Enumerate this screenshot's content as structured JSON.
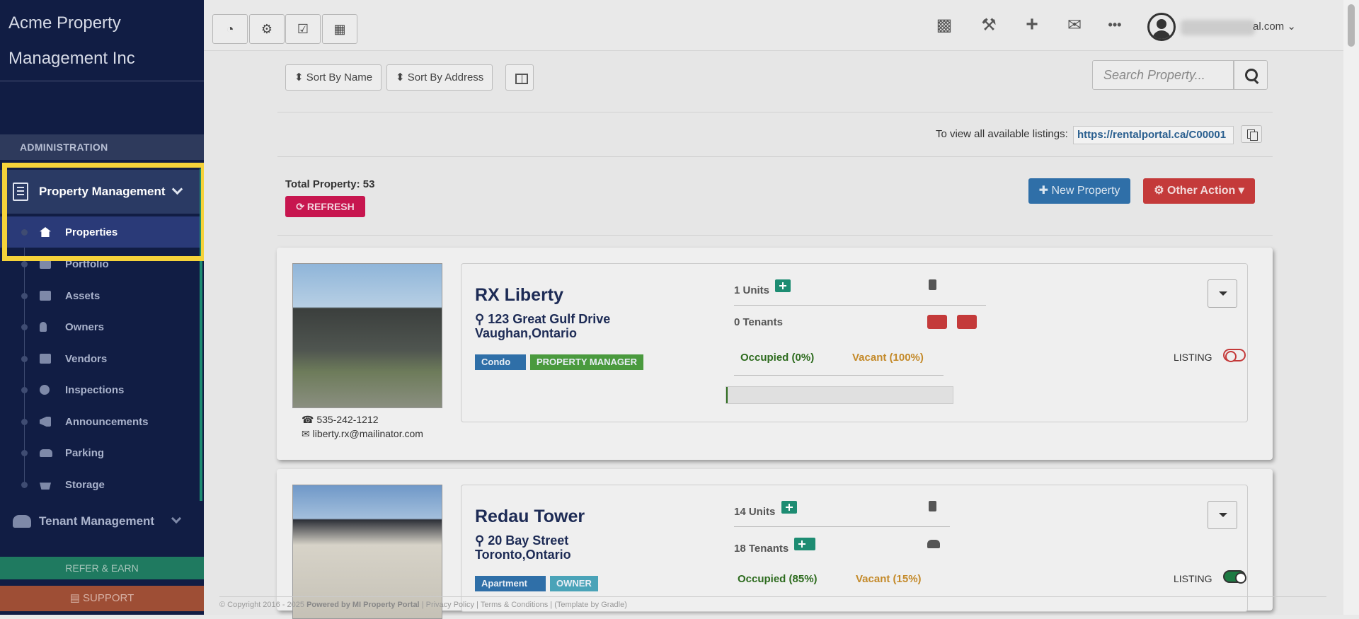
{
  "sidebar": {
    "brand": "Acme Property Management Inc",
    "section": "ADMINISTRATION",
    "group": {
      "label": "Property Management",
      "icon": "building-icon"
    },
    "items": [
      {
        "label": "Properties",
        "icon": "home-icon",
        "active": true
      },
      {
        "label": "Portfolio",
        "icon": "portfolio-icon"
      },
      {
        "label": "Assets",
        "icon": "archive-icon"
      },
      {
        "label": "Owners",
        "icon": "user-icon"
      },
      {
        "label": "Vendors",
        "icon": "briefcase-icon"
      },
      {
        "label": "Inspections",
        "icon": "search-plus-icon"
      },
      {
        "label": "Announcements",
        "icon": "bullhorn-icon"
      },
      {
        "label": "Parking",
        "icon": "car-icon"
      },
      {
        "label": "Storage",
        "icon": "basket-icon"
      }
    ],
    "tenant_group": "Tenant Management",
    "refer": "REFER & EARN",
    "support": "SUPPORT"
  },
  "topbar": {
    "left_icons": [
      "dashboard-icon",
      "gear-icon",
      "calendar-check-icon",
      "calculator-icon"
    ],
    "right_icons": [
      "bar-chart-icon",
      "wrench-icon",
      "plus-icon",
      "envelope-icon",
      "more-icon"
    ],
    "email_visible": "al.com"
  },
  "toolbar": {
    "sort_name": "⬍ Sort By Name",
    "sort_address": "⬍ Sort By Address",
    "search_placeholder": "Search Property..."
  },
  "listings": {
    "label": "To view all available listings:",
    "url": "https://rentalportal.ca/C00001"
  },
  "summary": {
    "total": "Total Property: 53",
    "refresh": "⟳ REFRESH",
    "new_property": "✚ New Property",
    "other_action": "⚙ Other Action ▾"
  },
  "properties": [
    {
      "name": "RX Liberty",
      "address1": "123 Great Gulf Drive",
      "address2": "Vaughan,Ontario",
      "type": "Condo",
      "role": "PROPERTY MANAGER",
      "units": "1 Units",
      "tenants": "0 Tenants",
      "occupied": "Occupied (0%)",
      "vacant": "Vacant (100%)",
      "occupancy": 0,
      "phone": "535-242-1212",
      "email": "liberty.rx@mailinator.com",
      "listing": "LISTING",
      "listing_on": false
    },
    {
      "name": "Redau Tower",
      "address1": "20 Bay Street",
      "address2": "Toronto,Ontario",
      "type": "Apartment",
      "role": "OWNER",
      "units": "14 Units",
      "tenants": "18 Tenants",
      "occupied": "Occupied (85%)",
      "vacant": "Vacant (15%)",
      "occupancy": 0.85,
      "listing": "LISTING",
      "listing_on": true
    }
  ],
  "footer": {
    "copyright": "© Copyright 2016 - 2025",
    "powered": "Powered by MI Property Portal",
    "links": "| Privacy Policy | Terms & Conditions |",
    "template": "(Template by Gradle)"
  }
}
